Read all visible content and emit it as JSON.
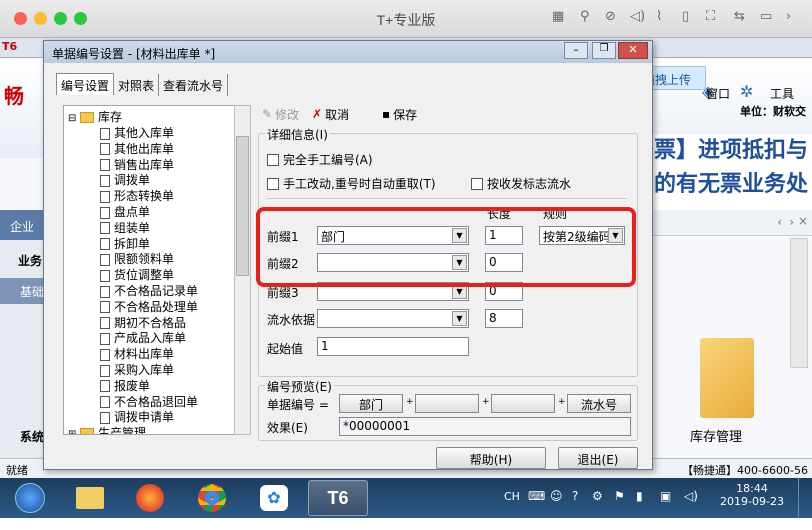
{
  "mac": {
    "title": "T+专业版"
  },
  "bgapp": {
    "menu_window": "窗口",
    "menu_tools": "工具",
    "unit": "单位：财软交",
    "banner_line1": "票】进项抵扣与",
    "banner_line2": "的有无票业务处",
    "left_tab1": "企业",
    "left_tab2": "业务",
    "left_tab3": "基础",
    "left_tab4": "系统",
    "right_caption": "库存管理",
    "status_left": "就绪",
    "status_right": "【畅捷通】400-6600-56"
  },
  "upload": {
    "label": "拖拽上传"
  },
  "dialog": {
    "title": "单据编号设置 - [材料出库单 *]",
    "tabs": [
      "编号设置",
      "对照表",
      "查看流水号"
    ],
    "tree_root": "库存",
    "tree_items": [
      "其他入库单",
      "其他出库单",
      "销售出库单",
      "调拨单",
      "形态转换单",
      "盘点单",
      "组装单",
      "拆卸单",
      "限额领料单",
      "货位调整单",
      "不合格品记录单",
      "不合格品处理单",
      "期初不合格品",
      "产成品入库单",
      "材料出库单",
      "采购入库单",
      "报废单",
      "不合格品退回单",
      "调拨申请单"
    ],
    "tree_next": "生产管理",
    "toolbar": {
      "modify": "修改",
      "cancel": "取消",
      "save": "保存"
    },
    "detail": {
      "label": "详细信息(I)",
      "manual_number": "完全手工编号(A)",
      "auto_renumber": "手工改动,重号时自动重取(T)",
      "by_send_flag": "按收发标志流水",
      "length_header": "长度",
      "rule_header": "规则",
      "prefix1_label": "前缀1",
      "prefix1_value": "部门",
      "prefix1_length": "1",
      "prefix1_rule": "按第2级编码",
      "prefix2_label": "前缀2",
      "prefix2_value": "",
      "prefix2_length": "0",
      "prefix3_label": "前缀3",
      "prefix3_value": "",
      "prefix3_length": "0",
      "serial_basis_label": "流水依据",
      "serial_basis_value": "",
      "serial_length": "8",
      "start_label": "起始值",
      "start_value": "1"
    },
    "preview": {
      "label": "编号预览(E)",
      "number_label": "单据编号 =",
      "part1": "部门",
      "part2": "",
      "part3": "",
      "part4": "流水号",
      "effect_label": "效果(E)",
      "effect_value": "*00000001"
    },
    "help": "帮助(H)",
    "exit": "退出(E)"
  },
  "taskbar": {
    "lang": "CH",
    "time": "18:44",
    "date": "2019-09-23",
    "t6": "T6"
  }
}
